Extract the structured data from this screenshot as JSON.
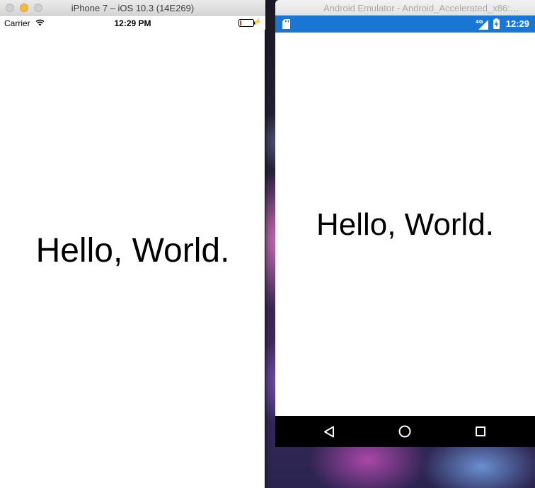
{
  "ios": {
    "window_title": "iPhone 7 – iOS 10.3 (14E269)",
    "carrier": "Carrier",
    "time": "12:29 PM",
    "content_text": "Hello, World."
  },
  "android": {
    "window_title": "Android Emulator - Android_Accelerated_x86:…",
    "network": "4G",
    "time": "12:29",
    "content_text": "Hello, World.",
    "statusbar_color": "#1976d2",
    "navbar_color": "#000000"
  },
  "icons": {
    "ios": [
      "close-icon",
      "minimize-icon",
      "zoom-icon",
      "wifi-icon",
      "battery-icon",
      "charging-bolt-icon"
    ],
    "android": [
      "sd-card-icon",
      "signal-4g-icon",
      "battery-charging-icon",
      "back-icon",
      "home-icon",
      "recent-apps-icon"
    ]
  }
}
